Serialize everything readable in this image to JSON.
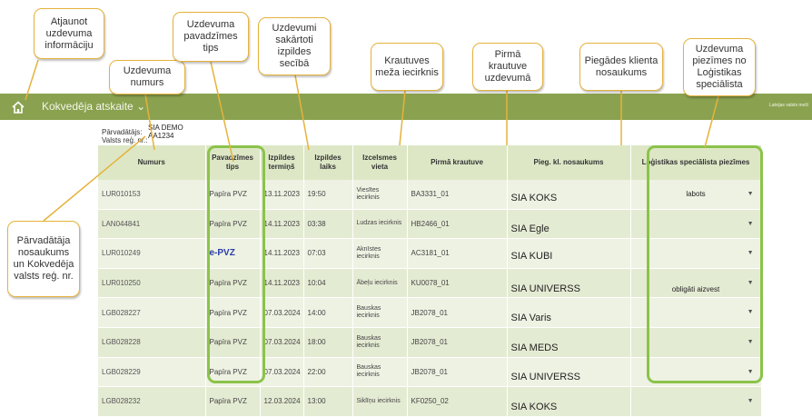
{
  "nav": {
    "title": "Kokvedēja atskaite ⌄",
    "right_text": "Latvijas valsts meži"
  },
  "carrier": {
    "label_carrier": "Pārvadātājs:",
    "label_reg": "Valsts reģ. nr.:",
    "name": "SIA DEMO",
    "reg": "AA1234"
  },
  "table": {
    "headers": [
      "Numurs",
      "Pavadzīmes tips",
      "Izpildes termiņš",
      "Izpildes laiks",
      "Izcelsmes vieta",
      "Pirmā krautuve",
      "Pieg. kl. nosaukums",
      "Loģistikas speciālista piezīmes"
    ],
    "rows": [
      {
        "num": "LUR010153",
        "type": "Papīra PVZ",
        "date": "13.11.2023",
        "time": "19:50",
        "loc": "Viesītes iecirknis",
        "first": "BA3331_01",
        "client": "SIA KOKS",
        "note": "labots"
      },
      {
        "num": "LAN044841",
        "type": "Papīra PVZ",
        "date": "14.11.2023",
        "time": "03:38",
        "loc": "Ludzas iecirknis",
        "first": "HB2466_01",
        "client": "SIA Egle",
        "note": ""
      },
      {
        "num": "LUR010249",
        "type": "e-PVZ",
        "date": "14.11.2023",
        "time": "07:03",
        "loc": "Aknīstes iecirknis",
        "first": "AC3181_01",
        "client": "SIA KUBI",
        "note": ""
      },
      {
        "num": "LUR010250",
        "type": "Papīra PVZ",
        "date": "14.11.2023",
        "time": "10:04",
        "loc": "Ābeļu iecirknis",
        "first": "KU0078_01",
        "client": "SIA UNIVERSS",
        "note": "obligāti aizvest"
      },
      {
        "num": "LGB028227",
        "type": "Papīra PVZ",
        "date": "07.03.2024",
        "time": "14:00",
        "loc": "Bauskas iecirknis",
        "first": "JB2078_01",
        "client": "SIA Varis",
        "note": ""
      },
      {
        "num": "LGB028228",
        "type": "Papīra PVZ",
        "date": "07.03.2024",
        "time": "18:00",
        "loc": "Bauskas iecirknis",
        "first": "JB2078_01",
        "client": "SIA MEDS",
        "note": ""
      },
      {
        "num": "LGB028229",
        "type": "Papīra PVZ",
        "date": "07.03.2024",
        "time": "22:00",
        "loc": "Bauskas iecirknis",
        "first": "JB2078_01",
        "client": "SIA UNIVERSS",
        "note": ""
      },
      {
        "num": "LGB028232",
        "type": "Papīra PVZ",
        "date": "12.03.2024",
        "time": "13:00",
        "loc": "Siklīņu iecirknis",
        "first": "KF0250_02",
        "client": "SIA KOKS",
        "note": ""
      }
    ]
  },
  "callouts": {
    "refresh": "Atjaunot uzdevuma informāciju",
    "task_number": "Uzdevuma numurs",
    "waybill_type": "Uzdevuma pavadzīmes tips",
    "sorted": "Uzdevumi sakārtoti izpildes secībā",
    "origin": "Krautuves meža iecirknis",
    "first_yard": "Pirmā krautuve uzdevumā",
    "client": "Piegādes klienta nosaukums",
    "notes": "Uzdevuma piezīmes no Loģistikas speciālista",
    "carrier": "Pārvadātāja nosaukums un Kokvedēja valsts reģ. nr."
  },
  "colors": {
    "navbar": "#8aa24f",
    "highlight": "#8bc34a",
    "callout_border": "#e6b23c",
    "header_bg": "#dde7c6"
  },
  "icons": {
    "home": "home-icon",
    "dropdown": "chevron-down-icon"
  }
}
